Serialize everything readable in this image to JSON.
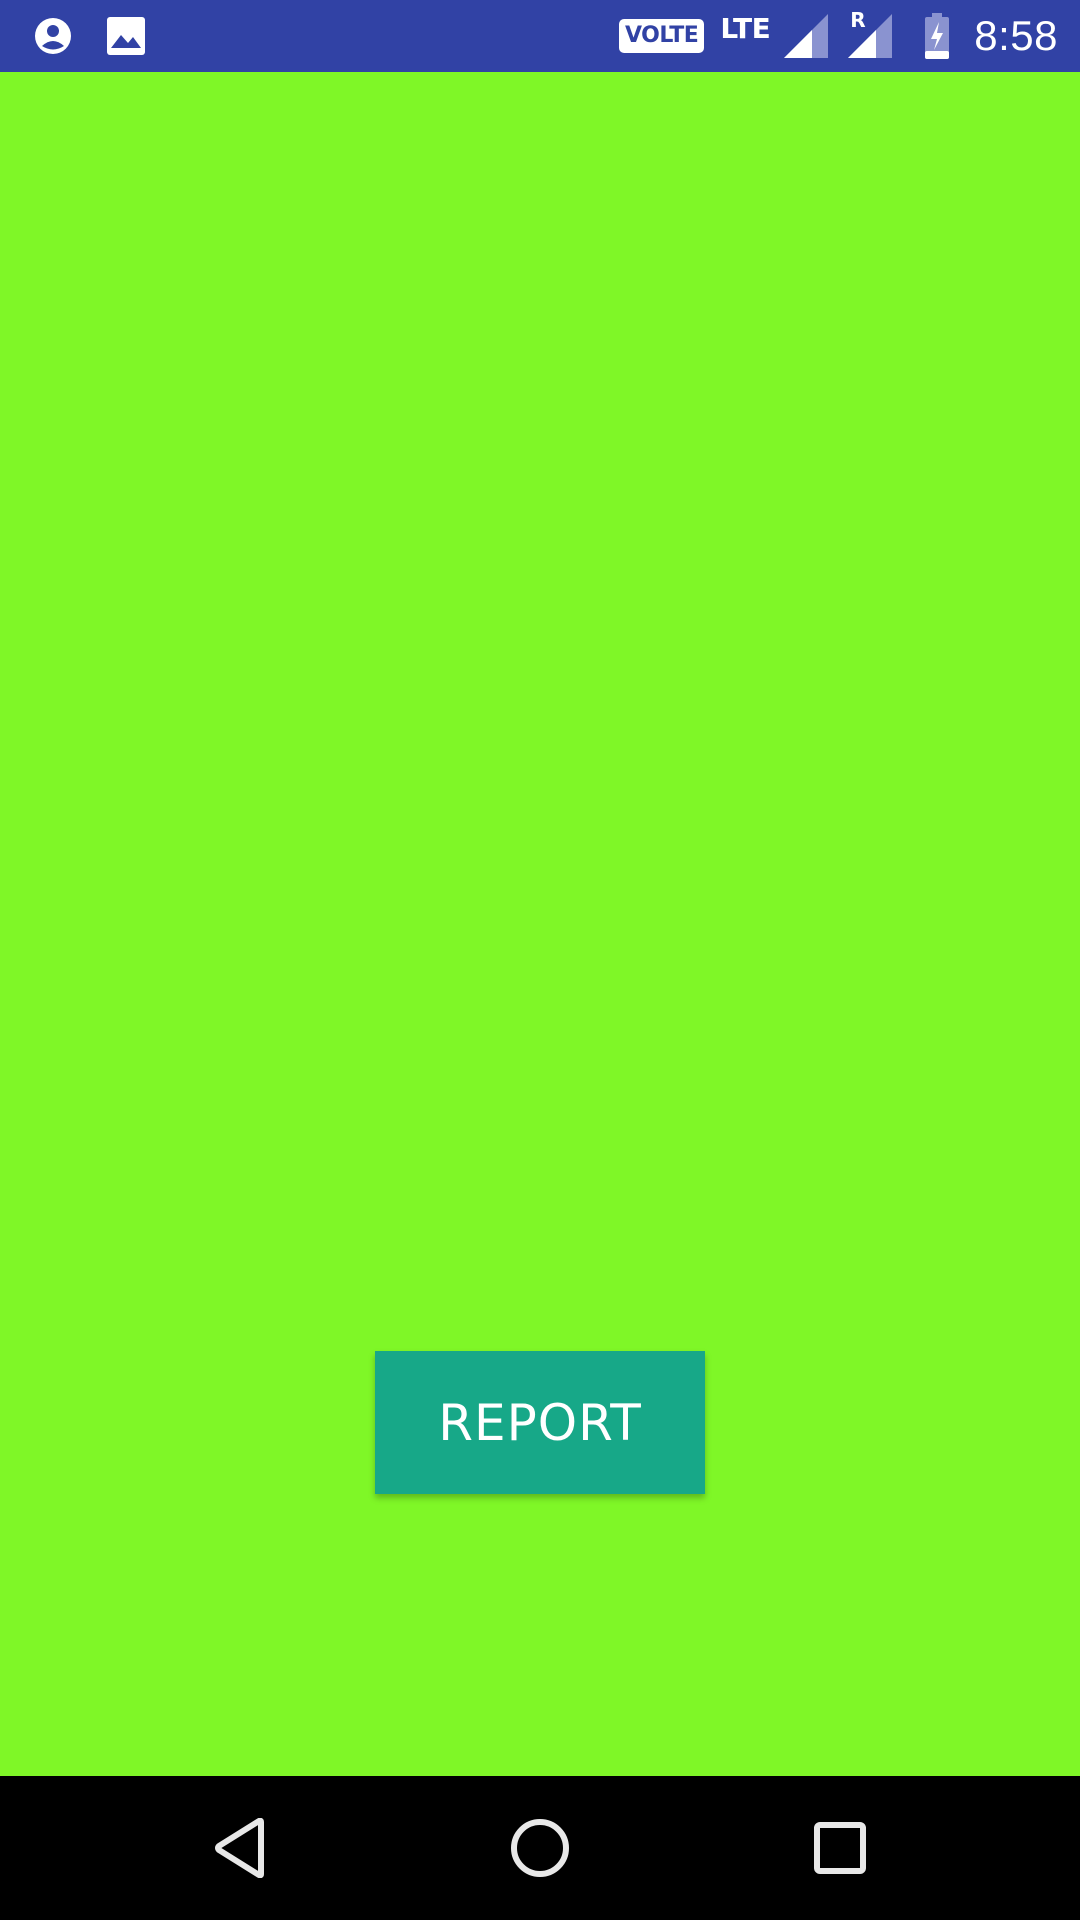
{
  "status_bar": {
    "left_icons": [
      "account-circle-icon",
      "image-icon"
    ],
    "volte": "VOLTE",
    "network": "LTE",
    "roaming": "R",
    "time": "8:58",
    "background_color": "#3142a5"
  },
  "main": {
    "background_color": "#7ff727",
    "report_button": {
      "label": "REPORT",
      "color": "#17a888"
    }
  },
  "nav_bar": {
    "buttons": [
      "back-icon",
      "home-icon",
      "recents-icon"
    ]
  }
}
